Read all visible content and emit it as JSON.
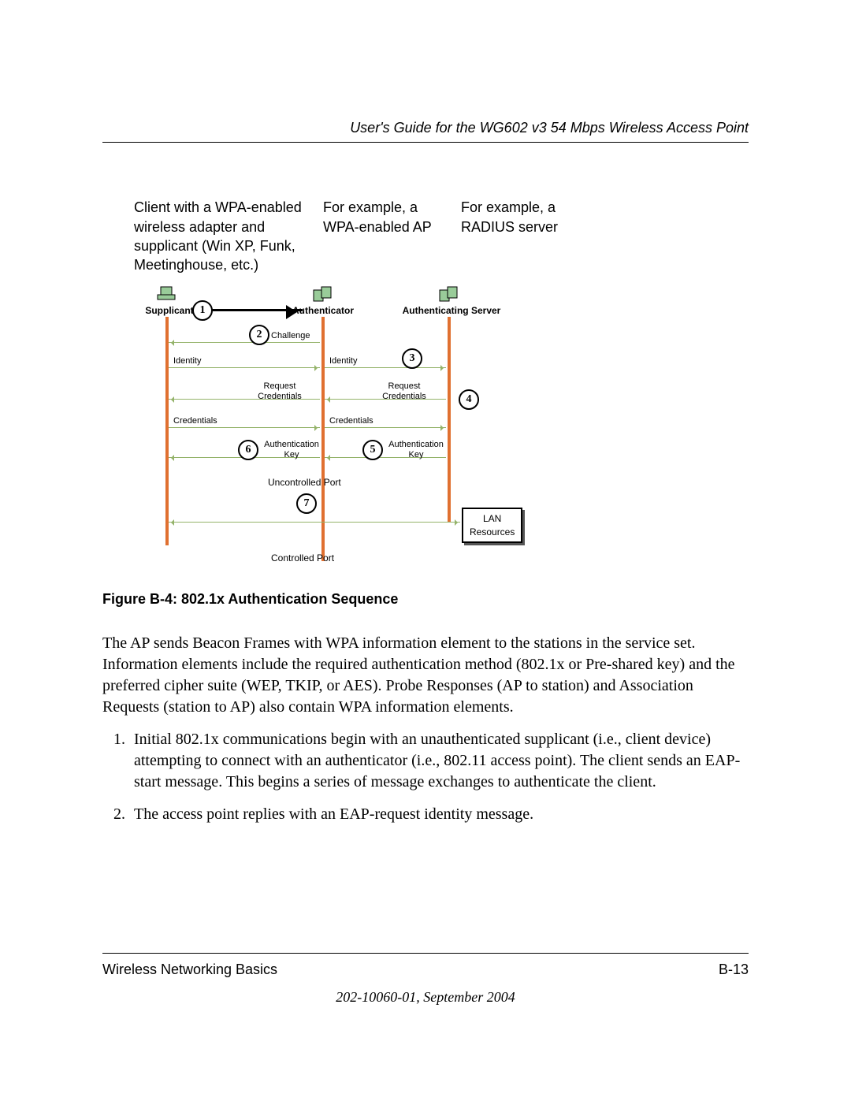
{
  "header": {
    "running_title": "User's Guide for the WG602 v3 54 Mbps Wireless Access Point"
  },
  "labels": {
    "client": "Client with a WPA-enabled wireless adapter and supplicant (Win XP, Funk, Meetinghouse, etc.)",
    "ap": "For example, a WPA-enabled AP",
    "server": "For example, a RADIUS server"
  },
  "diagram": {
    "nodes": {
      "supplicant": "Supplicant",
      "authenticator": "Authenticator",
      "server": "Authenticating Server"
    },
    "steps": {
      "s1": "1",
      "s2": "2",
      "s3": "3",
      "s4": "4",
      "s5": "5",
      "s6": "6",
      "s7": "7"
    },
    "msgs": {
      "challenge": "Challenge",
      "identity_l": "Identity",
      "identity_r": "Identity",
      "req_l": "Request Credentials",
      "req_r": "Request Credentials",
      "cred_l": "Credentials",
      "cred_r": "Credentials",
      "auth_l": "Authentication Key",
      "auth_r": "Authentication Key",
      "uncontrolled": "Uncontrolled Port",
      "controlled": "Controlled Port",
      "lan": "LAN Resources"
    }
  },
  "figure_caption": "Figure B-4:  802.1x Authentication Sequence",
  "body": {
    "intro": "The AP sends Beacon Frames with WPA information element to the stations in the service set. Information elements include the required authentication method (802.1x or Pre-shared key) and the preferred cipher suite (WEP, TKIP, or AES). Probe Responses (AP to station) and Association Requests (station to AP) also contain WPA information elements.",
    "step1": "Initial 802.1x communications begin with an unauthenticated supplicant (i.e., client device) attempting to connect with an authenticator (i.e., 802.11 access point). The client sends an EAP-start message. This begins a series of message exchanges to authenticate the client.",
    "step2": "The access point replies with an EAP-request identity message."
  },
  "footer": {
    "section": "Wireless Networking Basics",
    "page": "B-13",
    "docid": "202-10060-01, September 2004"
  }
}
